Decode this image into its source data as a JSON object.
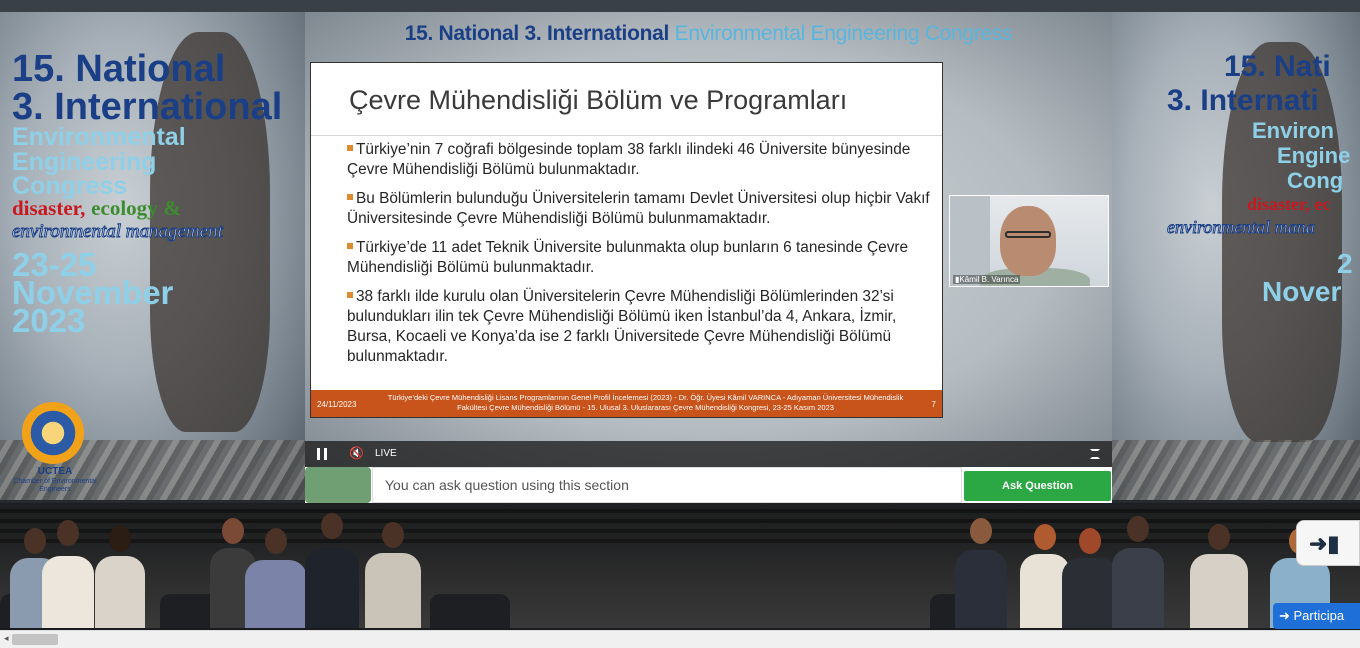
{
  "banner": {
    "line1": "15. National",
    "line2": "3. International",
    "line3": "Environmental",
    "line4": "Engineering",
    "line5": "Congress",
    "disaster": "disaster,",
    "ecology": "ecology",
    "amp": "&",
    "env_mgmt": "environmental management",
    "dates": "23-25",
    "month": "November",
    "year": "2023",
    "logo_name": "UCTEA",
    "logo_sub": "Chamber of Environmental Engineers"
  },
  "right_banner": {
    "line1": "15. Nati",
    "line2": "3. Internati",
    "line3": "Environ",
    "line4": "Engine",
    "line5": "Cong",
    "line6": "disaster, ec",
    "line7": "environmental mana",
    "dates": "2",
    "month": "Nover"
  },
  "player": {
    "title_main": "15. National 3. International",
    "title_highlight": "Environmental Engineering Congress",
    "live_label": "LIVE"
  },
  "slide": {
    "heading": "Çevre Mühendisliği Bölüm ve Programları",
    "bullets": [
      "Türkiye’nin 7 coğrafi bölgesinde toplam 38 farklı ilindeki 46 Üniversite bünyesinde Çevre Mühendisliği Bölümü bulunmaktadır.",
      "Bu Bölümlerin bulunduğu Üniversitelerin tamamı Devlet Üniversitesi olup hiçbir Vakıf Üniversitesinde Çevre Mühendisliği Bölümü bulunmamaktadır.",
      "Türkiye’de 11 adet Teknik Üniversite bulunmakta olup bunların 6 tanesinde Çevre Mühendisliği Bölümü bulunmaktadır.",
      "38 farklı ilde kurulu olan Üniversitelerin Çevre Mühendisliği Bölümlerinden 32’si bulundukları ilin tek Çevre Mühendisliği Bölümü iken İstanbul’da 4, Ankara, İzmir, Bursa, Kocaeli ve Konya’da ise 2 farklı Üniversitede Çevre Mühendisliği Bölümü bulunmaktadır."
    ],
    "footer_date": "24/11/2023",
    "footer_cite": "Türkiye’deki Çevre Mühendisliği Lisans Programlarının Genel Profil İncelemesi (2023) - Dr. Öğr. Üyesi Kâmil VARINCA - Adıyaman Üniversitesi Mühendislik Fakültesi Çevre Mühendisliği Bölümü - 15. Ulusal 3. Uluslararası Çevre Mühendisliği Kongresi, 23-25 Kasım 2023",
    "footer_page": "7"
  },
  "webcam": {
    "name": "Kâmil B. Varınca"
  },
  "question": {
    "placeholder": "You can ask question using this section",
    "button": "Ask Question"
  },
  "participants_label": "Participa",
  "colors": {
    "brand_blue": "#1a3f86",
    "highlight_blue": "#58b6de",
    "slide_footer": "#c8541b",
    "ask_button": "#2ba844",
    "participants_button": "#1e6fd8"
  }
}
